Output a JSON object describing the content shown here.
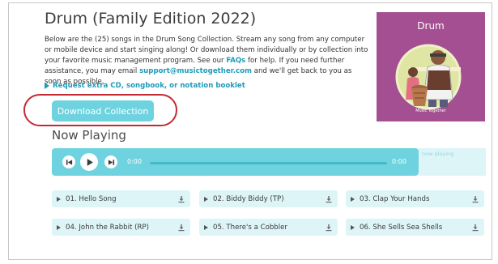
{
  "album": {
    "title": "Drum (Family Edition 2022)",
    "desc_1": "Below are the (25) songs in the Drum Song Collection. Stream any song from any computer or mobile device and start singing along! Or download them individually or by collection into your favorite music management program. See our ",
    "faqs_link": "FAQs",
    "desc_2": " for help. If you need further assistance, you may email ",
    "email_link": "support@musictogether.com",
    "desc_3": " and we'll get back to you as soon as possible.",
    "request_link": "Request extra CD, songbook, or notation booklet",
    "download_label": "Download Collection"
  },
  "cover": {
    "title": "Drum",
    "brand": "Music Together",
    "bg_color": "#a34f92"
  },
  "player": {
    "heading": "Now Playing",
    "current_time": "0:00",
    "duration": "0:00",
    "status": "now playing",
    "progress": 0
  },
  "songs": [
    {
      "label": "01. Hello Song"
    },
    {
      "label": "02. Biddy Biddy (TP)"
    },
    {
      "label": "03. Clap Your Hands"
    },
    {
      "label": "04. John the Rabbit (RP)"
    },
    {
      "label": "05. There's a Cobbler"
    },
    {
      "label": "06. She Sells Sea Shells"
    }
  ],
  "colors": {
    "accent": "#6fd3df",
    "link": "#1f9bb8",
    "highlight_circle": "#c42a36"
  }
}
